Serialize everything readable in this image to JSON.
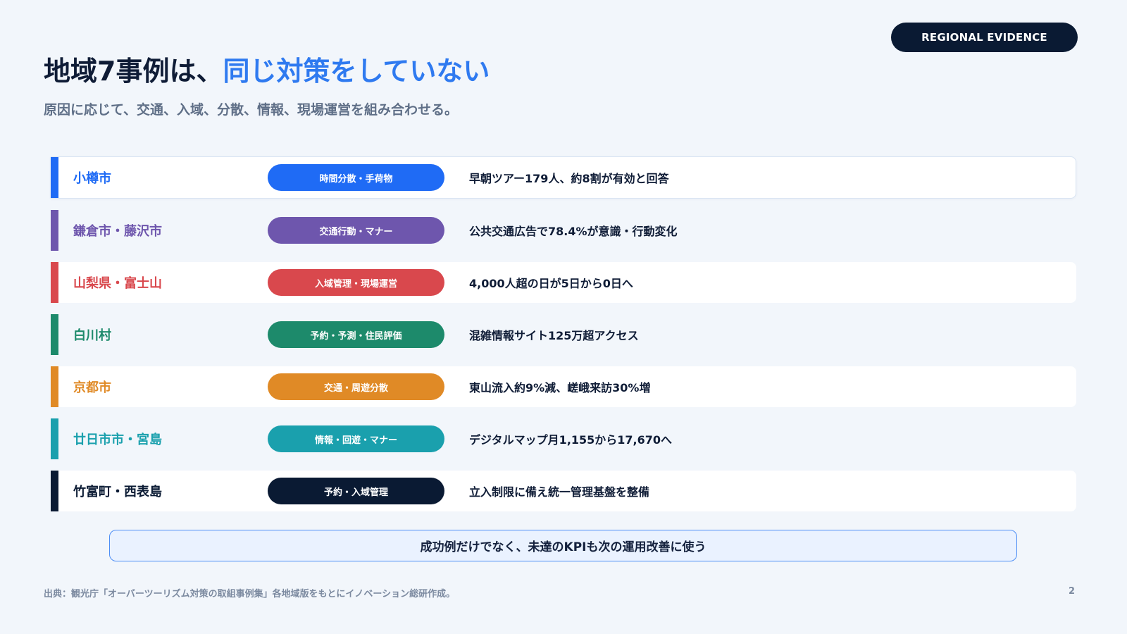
{
  "badge": "REGIONAL EVIDENCE",
  "title": {
    "main": "地域7事例は、",
    "accent": "同じ対策をしていない"
  },
  "subtitle": "原因に応じて、交通、入域、分散、情報、現場運営を組み合わせる。",
  "colors": {
    "accent": "#2f7af0",
    "otaru": "#1f6bf5",
    "kamakura": "#6e56ad",
    "yamanashi": "#d9484d",
    "shirakawa": "#1d8a6b",
    "kyoto": "#e08a26",
    "hatsukaichi": "#1aa0ad",
    "taketomi": "#0a1a33"
  },
  "cases": [
    {
      "region": "小樽市",
      "measure": "時間分散・手荷物",
      "result": "早朝ツアー179人、約8割が有効と回答"
    },
    {
      "region": "鎌倉市・藤沢市",
      "measure": "交通行動・マナー",
      "result": "公共交通広告で78.4%が意識・行動変化"
    },
    {
      "region": "山梨県・富士山",
      "measure": "入域管理・現場運営",
      "result": "4,000人超の日が5日から0日へ"
    },
    {
      "region": "白川村",
      "measure": "予約・予測・住民評価",
      "result": "混雑情報サイト125万超アクセス"
    },
    {
      "region": "京都市",
      "measure": "交通・周遊分散",
      "result": "東山流入約9%減、嵯峨来訪30%増"
    },
    {
      "region": "廿日市市・宮島",
      "measure": "情報・回遊・マナー",
      "result": "デジタルマップ月1,155から17,670へ"
    },
    {
      "region": "竹富町・西表島",
      "measure": "予約・入域管理",
      "result": "立入制限に備え統一管理基盤を整備"
    }
  ],
  "callout": "成功例だけでなく、未達のKPIも次の運用改善に使う",
  "source": "出典：観光庁「オーバーツーリズム対策の取組事例集」各地域版をもとにイノベーション総研作成。",
  "page_number": "2"
}
